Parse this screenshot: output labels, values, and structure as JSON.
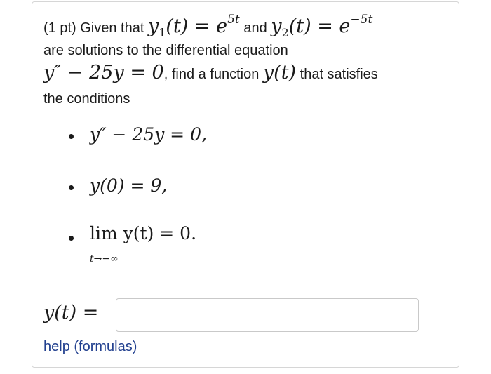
{
  "problem": {
    "line1": {
      "prefix": "(1 pt) Given that ",
      "y1_lhs": "y",
      "y1_sub": "1",
      "y1_arg": "(t) = e",
      "y1_exp": "5t",
      "mid": " and ",
      "y2_lhs": "y",
      "y2_sub": "2",
      "y2_arg": "(t) = e",
      "y2_exp": "−5t"
    },
    "line2": "are solutions to the differential equation",
    "line3": {
      "equation": "y″ − 25y = 0",
      "text1": ", find a function ",
      "func": "y(t)",
      "text2": " that satisfies"
    },
    "line4": "the conditions"
  },
  "conditions": [
    {
      "text": "y″ − 25y = 0,"
    },
    {
      "text": "y(0) = 9,"
    },
    {
      "main": "lim  y(t) = 0.",
      "subscript": "t→−∞"
    }
  ],
  "answer": {
    "label": "y(t) =",
    "value": "",
    "placeholder": ""
  },
  "help": {
    "link_text": "help (formulas)"
  },
  "colors": {
    "link": "#22408f",
    "border": "#d6d6d6",
    "text": "#1a1a1a"
  }
}
